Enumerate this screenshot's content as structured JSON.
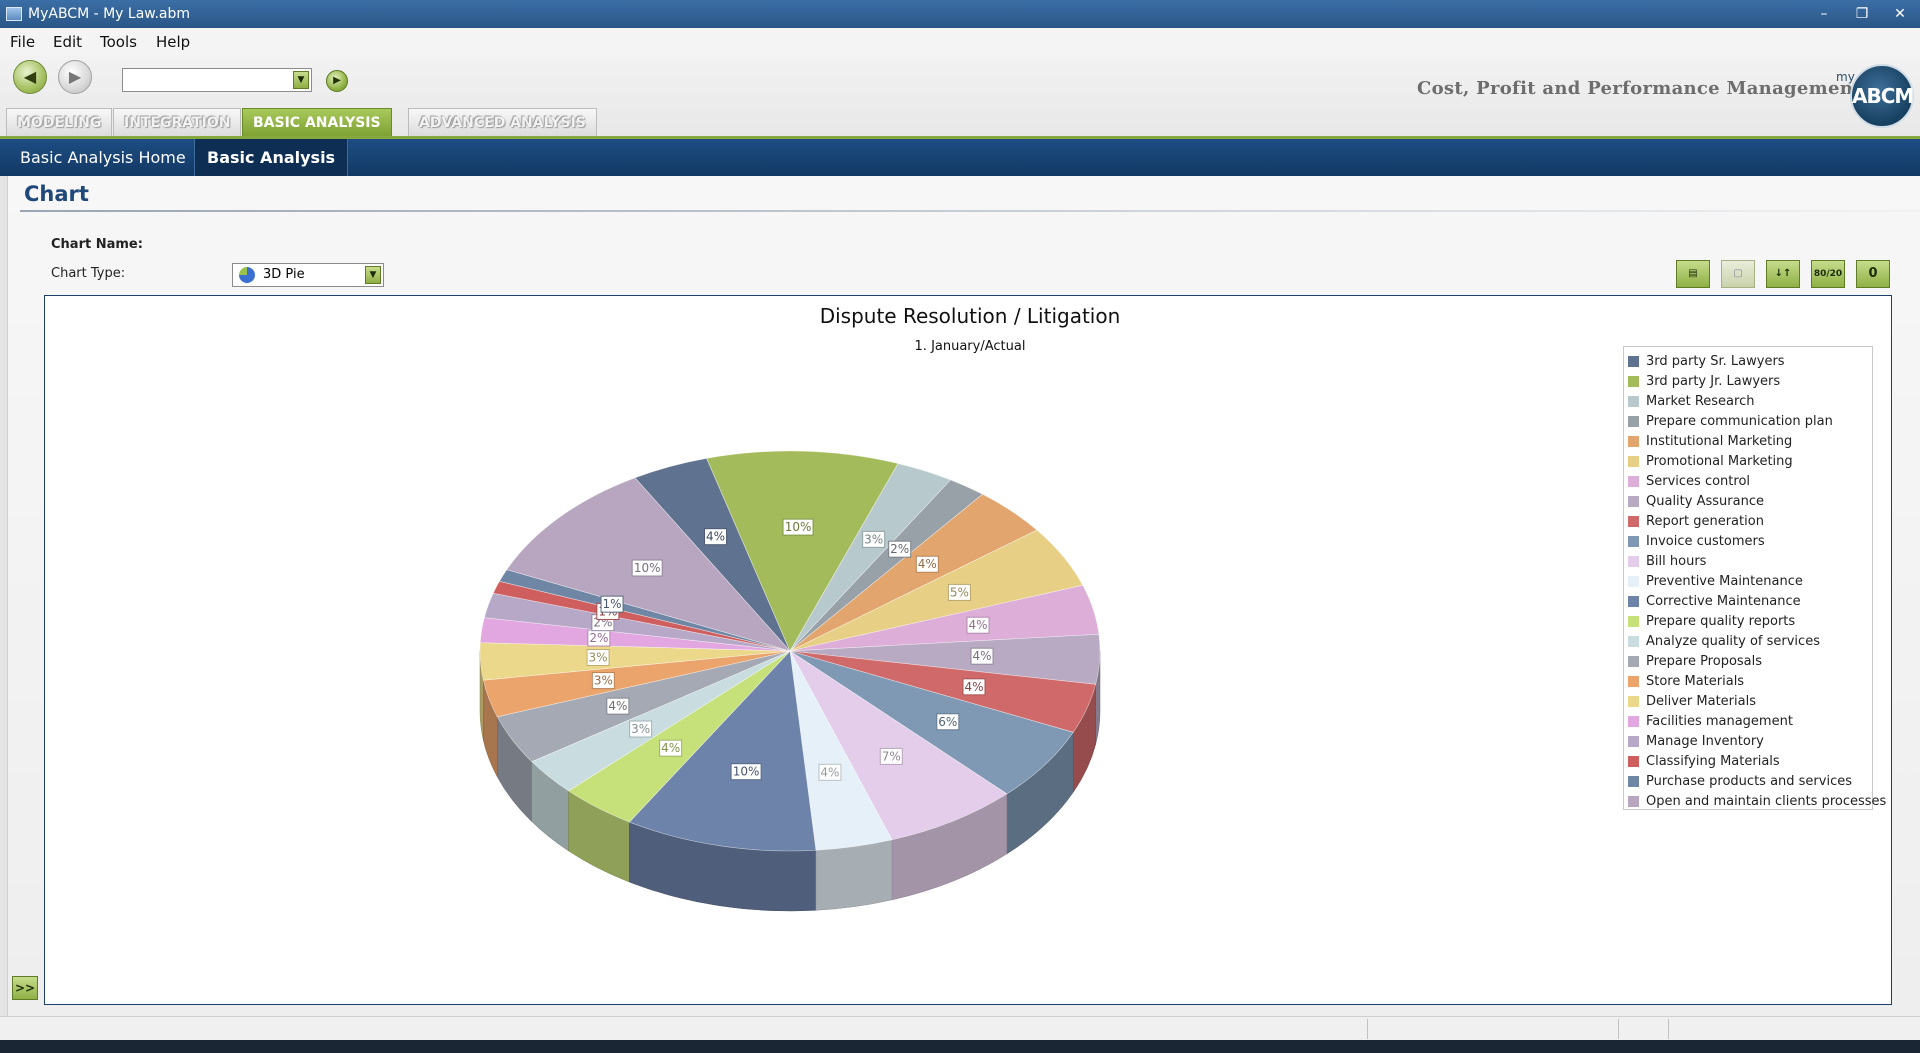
{
  "window": {
    "title": "MyABCM - My Law.abm",
    "minimize": "–",
    "restore": "❐",
    "close": "✕"
  },
  "menu": [
    {
      "label": "File"
    },
    {
      "label": "Edit"
    },
    {
      "label": "Tools"
    },
    {
      "label": "Help"
    }
  ],
  "toolbar": {
    "back_icon": "◀",
    "forward_icon": "▶",
    "go_icon": "▶",
    "combo_value": "",
    "combo_arrow": "▼"
  },
  "tagline": "Cost, Profit and Performance Management",
  "logo": {
    "my": "my",
    "text": "ABCM"
  },
  "tabs": [
    {
      "label": "MODELING",
      "active": false
    },
    {
      "label": "INTEGRATION",
      "active": false
    },
    {
      "label": "BASIC ANALYSIS",
      "active": true
    },
    {
      "label": "ADVANCED ANALYSIS",
      "active": false
    }
  ],
  "subnav": [
    {
      "label": "Basic Analysis Home",
      "active": false
    },
    {
      "label": "Basic Analysis",
      "active": true
    }
  ],
  "section_title": "Chart",
  "form": {
    "chart_name_label": "Chart Name:",
    "chart_name_value": "",
    "chart_type_label": "Chart Type:",
    "chart_type_value": "3D Pie"
  },
  "tool_buttons": [
    {
      "name": "table-view-button",
      "label": "▤",
      "disabled": false
    },
    {
      "name": "chart-view-button",
      "label": "▢",
      "disabled": true
    },
    {
      "name": "sort-button",
      "label": "↓↑",
      "disabled": false
    },
    {
      "name": "pareto-8020-button",
      "label": "80/20",
      "disabled": false
    },
    {
      "name": "zero-button",
      "label": "0",
      "disabled": false
    }
  ],
  "expand_button": ">>",
  "chart_data": {
    "type": "pie",
    "title": "Dispute Resolution / Litigation",
    "subtitle": "1. January/Actual",
    "legend_position": "right",
    "slices": [
      {
        "label": "3rd party Sr. Lawyers",
        "value": 4,
        "color": "#5f7290"
      },
      {
        "label": "3rd party Jr. Lawyers",
        "value": 10,
        "color": "#a4bb5b"
      },
      {
        "label": "Market Research",
        "value": 3,
        "color": "#b7c9cc"
      },
      {
        "label": "Prepare communication plan",
        "value": 2,
        "color": "#98a0a8"
      },
      {
        "label": "Institutional Marketing",
        "value": 4,
        "color": "#e1a56d"
      },
      {
        "label": "Promotional Marketing",
        "value": 5,
        "color": "#e7cf86"
      },
      {
        "label": "Services control",
        "value": 4,
        "color": "#dcaed8"
      },
      {
        "label": "Quality Assurance",
        "value": 4,
        "color": "#b7aac2"
      },
      {
        "label": "Report generation",
        "value": 4,
        "color": "#d06a6a"
      },
      {
        "label": "Invoice customers",
        "value": 6,
        "color": "#7f98b3"
      },
      {
        "label": "Bill hours",
        "value": 7,
        "color": "#e3cdea"
      },
      {
        "label": "Preventive Maintenance",
        "value": 4,
        "color": "#e6f0f8"
      },
      {
        "label": "Corrective Maintenance",
        "value": 10,
        "color": "#6e83aa"
      },
      {
        "label": "Prepare quality reports",
        "value": 4,
        "color": "#c6e07a"
      },
      {
        "label": "Analyze quality of services",
        "value": 3,
        "color": "#c9dde0"
      },
      {
        "label": "Prepare Proposals",
        "value": 4,
        "color": "#a4a9b4"
      },
      {
        "label": "Store Materials",
        "value": 3,
        "color": "#eaa46c"
      },
      {
        "label": "Deliver Materials",
        "value": 3,
        "color": "#ecd88a"
      },
      {
        "label": "Facilities management",
        "value": 2,
        "color": "#e2a6e0"
      },
      {
        "label": "Manage Inventory",
        "value": 2,
        "color": "#b7a8c8"
      },
      {
        "label": "Classifying Materials",
        "value": 1,
        "color": "#cf5f5f"
      },
      {
        "label": "Purchase products and services",
        "value": 1,
        "color": "#6f86a4"
      },
      {
        "label": "Open and maintain clients processes",
        "value": 10,
        "color": "#b8a6c0"
      }
    ]
  }
}
